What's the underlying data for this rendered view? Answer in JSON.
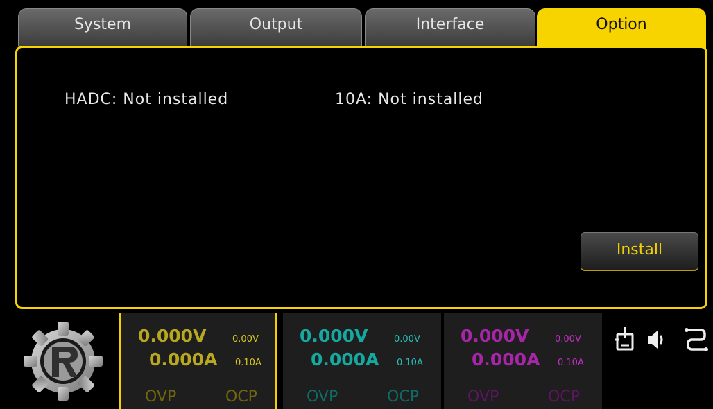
{
  "tabs": [
    {
      "label": "System",
      "active": false
    },
    {
      "label": "Output",
      "active": false
    },
    {
      "label": "Interface",
      "active": false
    },
    {
      "label": "Option",
      "active": true
    }
  ],
  "panel": {
    "hadc_status": "HADC: Not installed",
    "tenA_status": "10A: Not installed",
    "install_label": "Install"
  },
  "channels": [
    {
      "color": "#b8a820",
      "voltage": "0.000V",
      "current": "0.000A",
      "set_voltage": "0.00V",
      "set_current": "0.10A",
      "ovp": "OVP",
      "ocp": "OCP",
      "selected": true
    },
    {
      "color": "#15a9a0",
      "voltage": "0.000V",
      "current": "0.000A",
      "set_voltage": "0.00V",
      "set_current": "0.10A",
      "ovp": "OVP",
      "ocp": "OCP",
      "selected": false
    },
    {
      "color": "#a726a7",
      "voltage": "0.000V",
      "current": "0.000A",
      "set_voltage": "0.00V",
      "set_current": "0.10A",
      "ovp": "OVP",
      "ocp": "OCP",
      "selected": false
    }
  ],
  "status_icons": [
    "remote-lock-icon",
    "speaker-icon",
    "lan-icon"
  ],
  "accent_color": "#f7d300"
}
